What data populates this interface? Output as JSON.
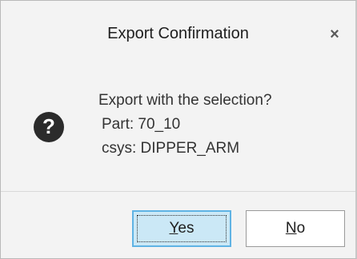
{
  "dialog": {
    "title": "Export Confirmation",
    "close_glyph": "×",
    "message_line1": "Export with the selection?",
    "message_line2": "Part: 70_10",
    "message_line3": "csys: DIPPER_ARM",
    "icon": "question-icon"
  },
  "buttons": {
    "yes_mnemonic": "Y",
    "yes_rest": "es",
    "no_mnemonic": "N",
    "no_rest": "o"
  },
  "colors": {
    "background": "#f3f3f3",
    "primary_button_fill": "#cbe8f6",
    "primary_button_border": "#5fb3e4"
  }
}
